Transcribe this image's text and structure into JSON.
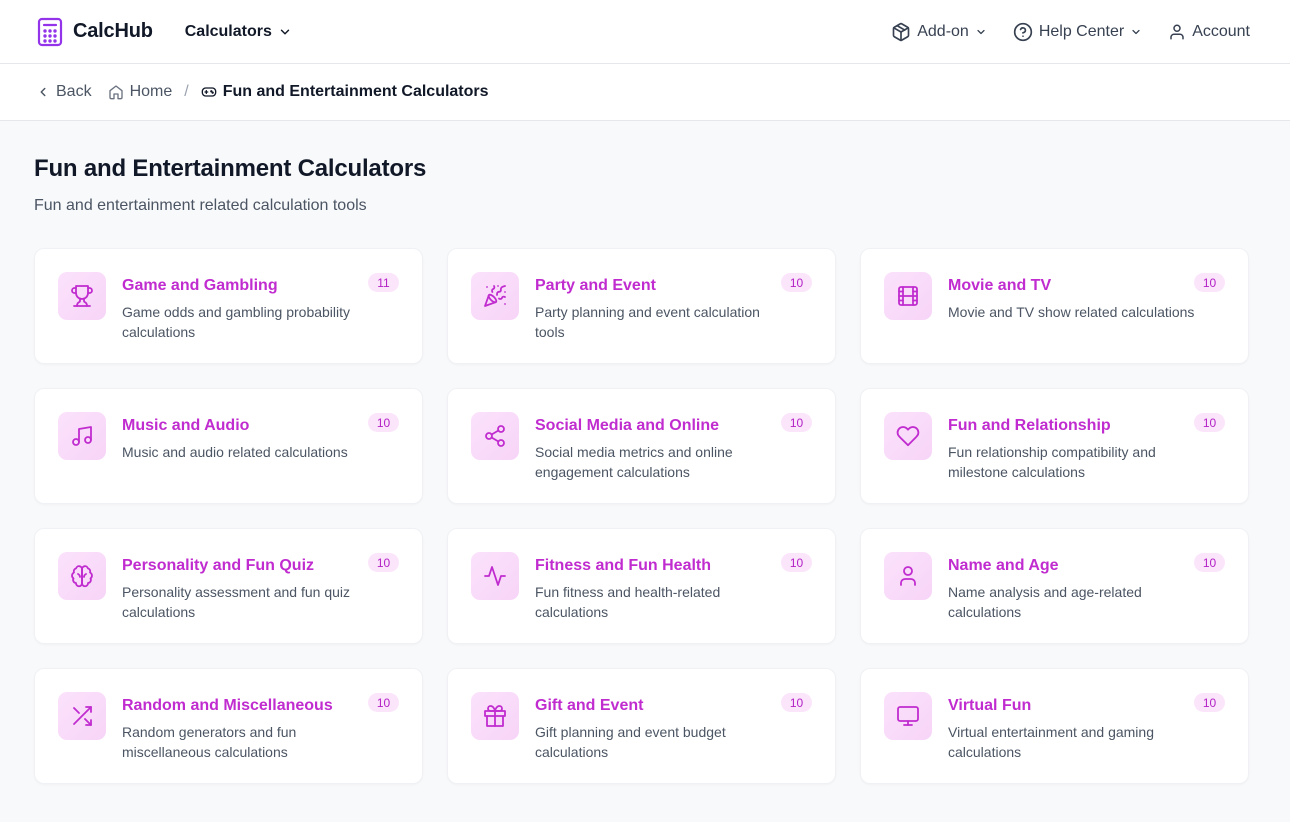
{
  "brand": {
    "name": "CalcHub"
  },
  "nav": {
    "calculators_label": "Calculators",
    "addon_label": "Add-on",
    "help_label": "Help Center",
    "account_label": "Account"
  },
  "breadcrumb": {
    "back_label": "Back",
    "home_label": "Home",
    "separator": "/",
    "current_label": "Fun and Entertainment Calculators"
  },
  "page": {
    "title": "Fun and Entertainment Calculators",
    "subtitle": "Fun and entertainment related calculation tools"
  },
  "accent_color": "#c02ccf",
  "categories": [
    {
      "title": "Game and Gambling",
      "desc": "Game odds and gambling probability calculations",
      "count": "11",
      "icon": "trophy-icon"
    },
    {
      "title": "Party and Event",
      "desc": "Party planning and event calculation tools",
      "count": "10",
      "icon": "party-popper-icon"
    },
    {
      "title": "Movie and TV",
      "desc": "Movie and TV show related calculations",
      "count": "10",
      "icon": "film-icon"
    },
    {
      "title": "Music and Audio",
      "desc": "Music and audio related calculations",
      "count": "10",
      "icon": "music-note-icon"
    },
    {
      "title": "Social Media and Online",
      "desc": "Social media metrics and online engagement calculations",
      "count": "10",
      "icon": "share-icon"
    },
    {
      "title": "Fun and Relationship",
      "desc": "Fun relationship compatibility and milestone calculations",
      "count": "10",
      "icon": "heart-icon"
    },
    {
      "title": "Personality and Fun Quiz",
      "desc": "Personality assessment and fun quiz calculations",
      "count": "10",
      "icon": "brain-icon"
    },
    {
      "title": "Fitness and Fun Health",
      "desc": "Fun fitness and health-related calculations",
      "count": "10",
      "icon": "activity-icon"
    },
    {
      "title": "Name and Age",
      "desc": "Name analysis and age-related calculations",
      "count": "10",
      "icon": "user-icon"
    },
    {
      "title": "Random and Miscellaneous",
      "desc": "Random generators and fun miscellaneous calculations",
      "count": "10",
      "icon": "shuffle-icon"
    },
    {
      "title": "Gift and Event",
      "desc": "Gift planning and event budget calculations",
      "count": "10",
      "icon": "gift-icon"
    },
    {
      "title": "Virtual Fun",
      "desc": "Virtual entertainment and gaming calculations",
      "count": "10",
      "icon": "monitor-icon"
    }
  ]
}
